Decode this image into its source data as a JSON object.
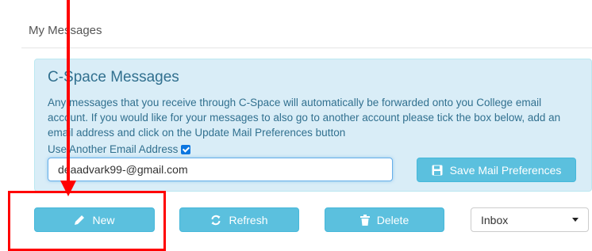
{
  "page": {
    "title": "My Messages"
  },
  "panel": {
    "heading": "C-Space Messages",
    "description": "Any messages that you receive through C-Space will automatically be forwarded onto you College email account. If you would like for your messages to also go to another account please tick the box below, add an email address and click on the Update Mail Preferences button",
    "checkbox_label": "Use Another Email Address",
    "checkbox_checked": true,
    "email_value": "deaadvark99-@gmail.com",
    "save_button_label": "Save Mail Preferences"
  },
  "toolbar": {
    "new_label": "New",
    "refresh_label": "Refresh",
    "delete_label": "Delete",
    "folder_selected": "Inbox"
  },
  "colors": {
    "info_button": "#5bc0de",
    "panel_bg": "#d9edf7",
    "panel_text": "#31708f",
    "annotation": "#ff0000"
  },
  "icons": {
    "save": "floppy-disk-icon",
    "new": "pencil-icon",
    "refresh": "refresh-icon",
    "delete": "trash-icon",
    "select": "caret-down-icon",
    "checkbox": "checkmark-icon"
  }
}
